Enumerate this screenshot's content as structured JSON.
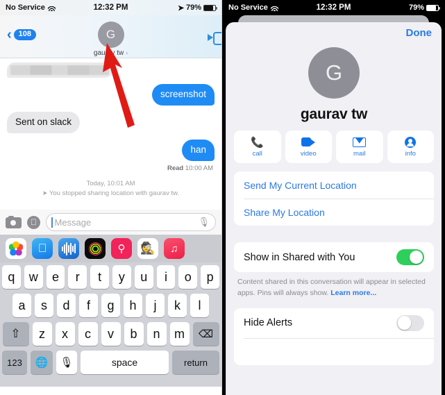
{
  "left_phone": {
    "status_bar": {
      "carrier": "No Service",
      "wifi_icon": "wifi-icon",
      "time": "12:32 PM",
      "location_icon": "location-arrow-icon",
      "battery_percent": "79%",
      "battery_icon": "battery-icon"
    },
    "nav_bar": {
      "back_icon": "chevron-left-icon",
      "unread_badge": "108",
      "avatar_initial": "G",
      "contact_name": "gaurav tw",
      "disclosure_icon": "chevron-right-icon",
      "facetime_icon": "video-camera-icon"
    },
    "thread": {
      "messages": [
        {
          "direction": "incoming",
          "text": "",
          "redacted": true
        },
        {
          "direction": "outgoing",
          "text": "screenshot",
          "redacted": false
        },
        {
          "direction": "incoming",
          "text": "Sent on slack",
          "redacted": false
        },
        {
          "direction": "outgoing",
          "text": "han",
          "redacted": false
        }
      ],
      "read_receipt_label": "Read",
      "read_receipt_time": "10:00 AM",
      "system_timestamp": "Today, 10:01 AM",
      "system_message": "You stopped sharing location with gaurav tw.",
      "system_icon": "location-arrow-icon"
    },
    "input_bar": {
      "camera_icon": "camera-icon",
      "appstore_icon": "app-store-icon",
      "message_placeholder": "Message",
      "message_value": "",
      "mic_icon": "microphone-icon"
    },
    "app_drawer": {
      "apps": [
        {
          "name": "photos-app-icon",
          "label": "Photos"
        },
        {
          "name": "app-store-app-icon",
          "label": "App Store"
        },
        {
          "name": "audio-message-app-icon",
          "label": "Audio"
        },
        {
          "name": "activity-app-icon",
          "label": "Fitness"
        },
        {
          "name": "images-search-app-icon",
          "label": "#images"
        },
        {
          "name": "memoji-app-icon",
          "label": "Memoji"
        },
        {
          "name": "music-app-icon",
          "label": "Music"
        }
      ]
    },
    "keyboard": {
      "row1": [
        "q",
        "w",
        "e",
        "r",
        "t",
        "y",
        "u",
        "i",
        "o",
        "p"
      ],
      "row2": [
        "a",
        "s",
        "d",
        "f",
        "g",
        "h",
        "j",
        "k",
        "l"
      ],
      "row3_letters": [
        "z",
        "x",
        "c",
        "v",
        "b",
        "n",
        "m"
      ],
      "shift_icon": "shift-icon",
      "backspace_icon": "backspace-icon",
      "numeric_key": "123",
      "globe_icon": "globe-icon",
      "dictation_icon": "microphone-icon",
      "space_key": "space",
      "return_key": "return"
    }
  },
  "right_phone": {
    "status_bar": {
      "carrier": "No Service",
      "wifi_icon": "wifi-icon",
      "time": "12:32 PM",
      "battery_percent": "79%",
      "battery_icon": "battery-icon"
    },
    "sheet": {
      "done_label": "Done",
      "avatar_initial": "G",
      "contact_name": "gaurav tw",
      "actions": [
        {
          "icon": "phone-icon",
          "label": "call"
        },
        {
          "icon": "video-camera-icon",
          "label": "video"
        },
        {
          "icon": "envelope-icon",
          "label": "mail"
        },
        {
          "icon": "person-circle-icon",
          "label": "info"
        }
      ],
      "location_rows": [
        "Send My Current Location",
        "Share My Location"
      ],
      "shared_with_you": {
        "label": "Show in Shared with You",
        "state": "on"
      },
      "footnote_text": "Content shared in this conversation will appear in selected apps. Pins will always show.",
      "footnote_link": "Learn more...",
      "hide_alerts": {
        "label": "Hide Alerts",
        "state": "off"
      }
    }
  },
  "annotations": {
    "arrow_color": "#e01b16",
    "arrow_left_target": "contact-name-header",
    "arrow_right_target": "send-my-current-location-row"
  }
}
